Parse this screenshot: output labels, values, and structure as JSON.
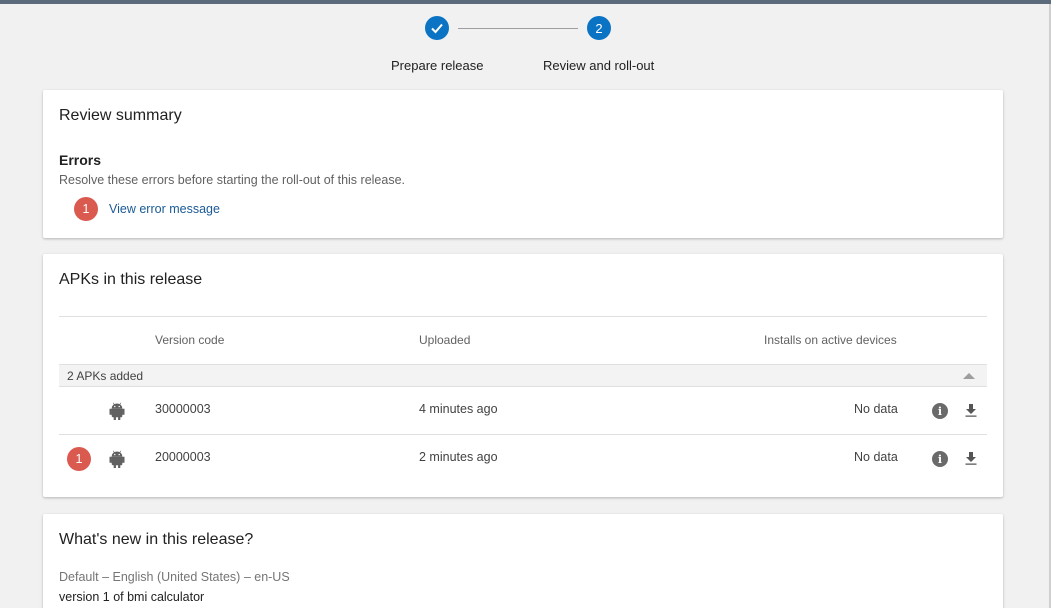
{
  "stepper": {
    "steps": [
      {
        "label": "Prepare release",
        "state": "done",
        "icon": "check-icon"
      },
      {
        "label": "Review and roll-out",
        "state": "active",
        "number": "2"
      }
    ]
  },
  "review": {
    "title": "Review summary",
    "errors_title": "Errors",
    "errors_description": "Resolve these errors before starting the roll-out of this release.",
    "error_count": "1",
    "error_link": "View error message"
  },
  "apks": {
    "title": "APKs in this release",
    "columns": {
      "version_code": "Version code",
      "uploaded": "Uploaded",
      "installs": "Installs on active devices"
    },
    "group_label": "2 APKs added",
    "rows": [
      {
        "error_count": "",
        "version_code": "30000003",
        "uploaded": "4 minutes ago",
        "installs": "No data"
      },
      {
        "error_count": "1",
        "version_code": "20000003",
        "uploaded": "2 minutes ago",
        "installs": "No data"
      }
    ]
  },
  "whats_new": {
    "title": "What's new in this release?",
    "locale": "Default – English (United States) – en-US",
    "notes": "version 1 of bmi calculator"
  },
  "colors": {
    "accent": "#0b73c4",
    "error": "#db5a50",
    "link": "#1a5a96"
  }
}
